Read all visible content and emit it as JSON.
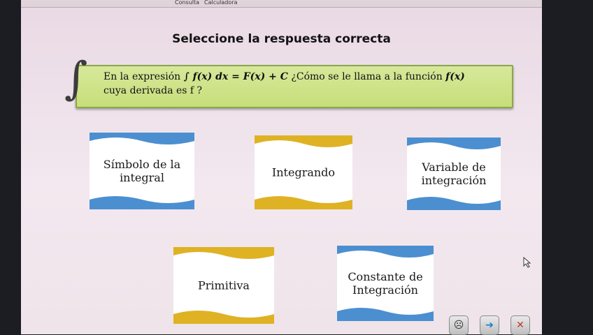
{
  "window": {
    "top_label_1": "Consulta",
    "top_label_2": "Calculadora"
  },
  "title": "Seleccione la respuesta correcta",
  "question": {
    "prefix": "En la expresión",
    "formula": "∫ f(x) dx = F(x) + C",
    "line1_suffix": "¿Cómo se le llama a la función",
    "function_name": "f(x)",
    "line2": "cuya derivada es f ?"
  },
  "options": [
    {
      "label_line1": "Símbolo de la",
      "label_line2": "integral",
      "color": "#5b9bd5"
    },
    {
      "label_line1": "Integrando",
      "label_line2": "",
      "color": "#e0b52a"
    },
    {
      "label_line1": "Variable de",
      "label_line2": "integración",
      "color": "#5b9bd5"
    },
    {
      "label_line1": "Primitiva",
      "label_line2": "",
      "color": "#e0b52a"
    },
    {
      "label_line1": "Constante de",
      "label_line2": "Integración",
      "color": "#5b9bd5"
    }
  ],
  "nav_buttons": [
    {
      "icon": "sad-face-icon",
      "symbol": "☹"
    },
    {
      "icon": "next-arrow-icon",
      "symbol": "➔"
    },
    {
      "icon": "close-x-icon",
      "symbol": "✕"
    }
  ]
}
